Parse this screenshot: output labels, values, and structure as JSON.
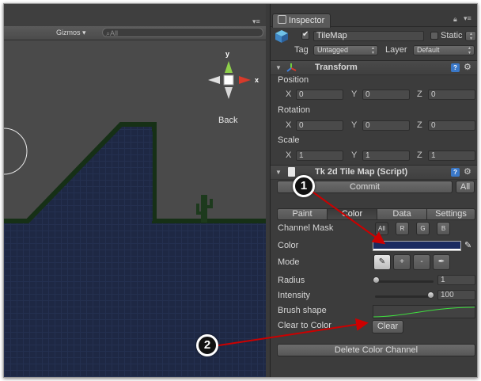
{
  "scene": {
    "gizmos_label": "Gizmos",
    "search_placeholder": "All",
    "orientation_label": "Back",
    "axis_y": "y",
    "axis_x": "x"
  },
  "inspector": {
    "tab_label": "Inspector",
    "object_name": "TileMap",
    "static_label": "Static",
    "tag_label": "Tag",
    "tag_value": "Untagged",
    "layer_label": "Layer",
    "layer_value": "Default"
  },
  "transform": {
    "title": "Transform",
    "position_label": "Position",
    "rotation_label": "Rotation",
    "scale_label": "Scale",
    "axes": [
      "X",
      "Y",
      "Z"
    ],
    "position": [
      "0",
      "0",
      "0"
    ],
    "rotation": [
      "0",
      "0",
      "0"
    ],
    "scale": [
      "1",
      "1",
      "1"
    ]
  },
  "tilemap": {
    "title": "Tk 2d Tile Map (Script)",
    "commit_label": "Commit",
    "all_label": "All",
    "tabs": [
      "Paint",
      "Color",
      "Data",
      "Settings"
    ],
    "channel_mask_label": "Channel Mask",
    "channels": [
      "All",
      "R",
      "G",
      "B"
    ],
    "color_label": "Color",
    "color_value": "#1b2b61",
    "mode_label": "Mode",
    "mode_buttons": [
      "pencil-icon",
      "plus-icon",
      "minus-icon",
      "eyedropper-icon"
    ],
    "radius_label": "Radius",
    "radius_value": "1",
    "radius_level": 0.02,
    "intensity_label": "Intensity",
    "intensity_value": "100",
    "intensity_level": 1.0,
    "brush_shape_label": "Brush shape",
    "clear_to_color_label": "Clear to Color",
    "clear_label": "Clear",
    "delete_channel_label": "Delete Color Channel"
  },
  "callouts": [
    "1",
    "2"
  ],
  "colors": {
    "annotation_arrow": "#cc0000",
    "sky": "#4a4a4a",
    "ground": "#1e2844",
    "grass": "#163016",
    "cactus": "#1d3a1d"
  }
}
